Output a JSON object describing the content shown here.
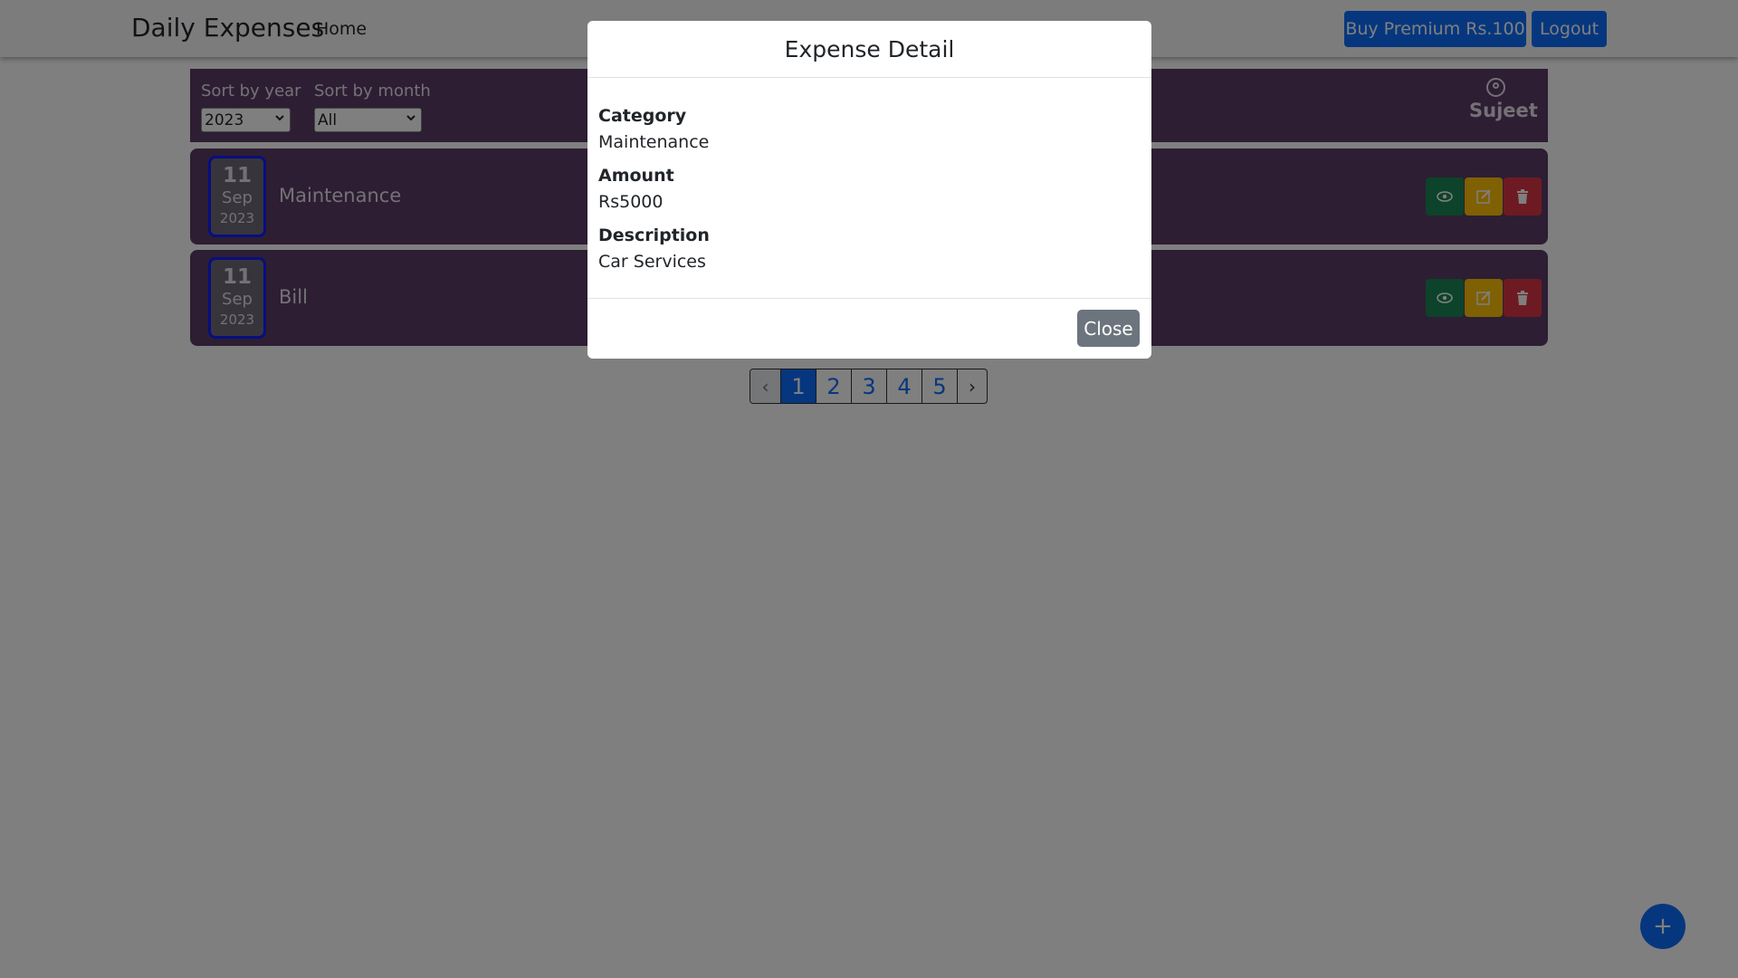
{
  "navbar": {
    "brand": "Daily Expenses",
    "home_link": "Home",
    "premium_button": "Buy Premium Rs.100",
    "logout_button": "Logout"
  },
  "filters": {
    "year_label": "Sort by year",
    "year_value": "2023",
    "month_label": "Sort by month",
    "month_value": "All"
  },
  "user": {
    "name": "Sujeet",
    "icon": "user-circle-icon"
  },
  "expenses": [
    {
      "day": "11",
      "month": "Sep",
      "year": "2023",
      "category": "Maintenance"
    },
    {
      "day": "11",
      "month": "Sep",
      "year": "2023",
      "category": "Bill"
    }
  ],
  "actions": {
    "view_icon": "eye-icon",
    "edit_icon": "edit-icon",
    "delete_icon": "trash-icon"
  },
  "pagination": {
    "prev": "‹",
    "next": "›",
    "pages": [
      "1",
      "2",
      "3",
      "4",
      "5"
    ],
    "current": "1"
  },
  "fab": {
    "label": "+"
  },
  "modal": {
    "title": "Expense Detail",
    "category_label": "Category",
    "category_value": "Maintenance",
    "amount_label": "Amount",
    "amount_value": "Rs5000",
    "description_label": "Description",
    "description_value": "Car Services",
    "close_button": "Close"
  },
  "colors": {
    "primary": "#0d6efd",
    "card_bg": "#5a3d66",
    "view": "#198754",
    "edit": "#ffc107",
    "delete": "#dc3545",
    "secondary": "#6c757d"
  }
}
